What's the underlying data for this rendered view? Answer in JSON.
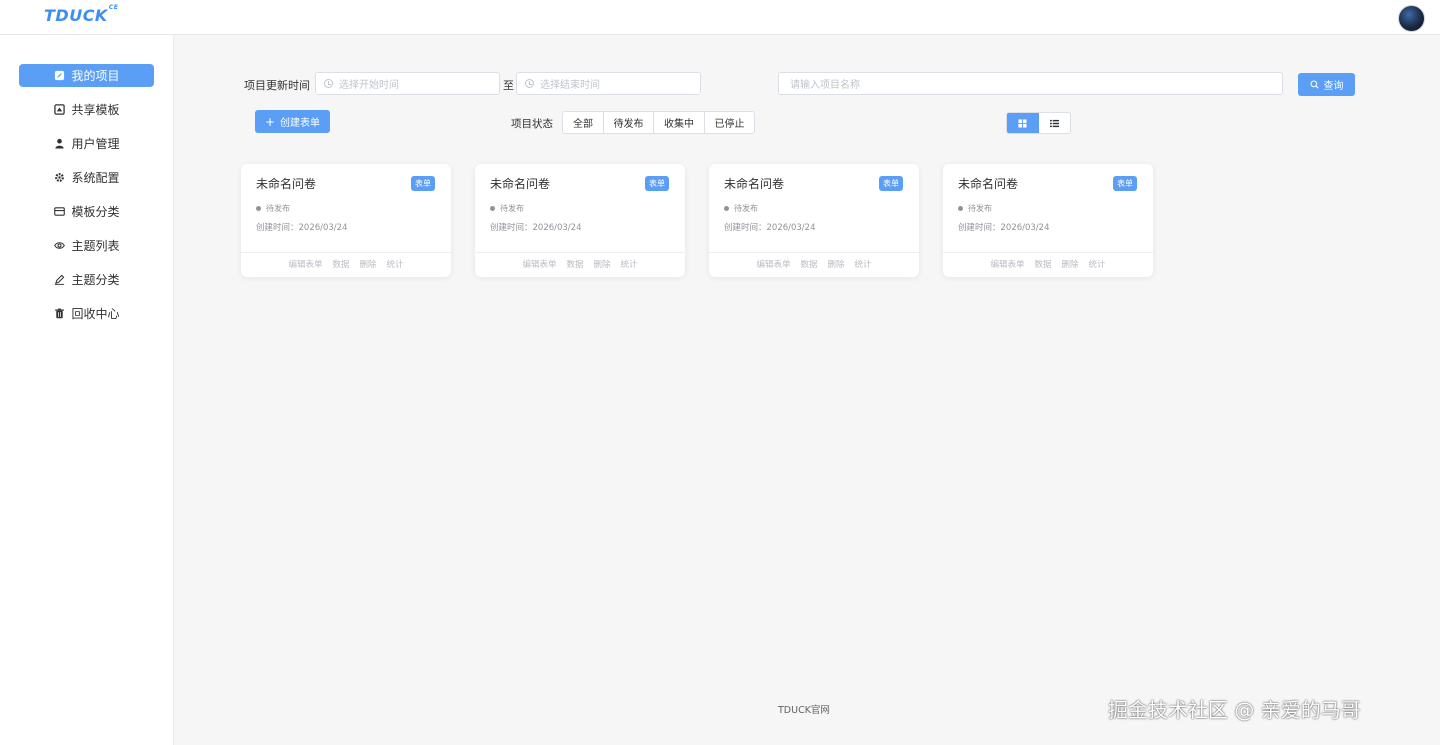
{
  "header": {
    "logo": "TDUCK",
    "logo_sup": "CE"
  },
  "sidebar": {
    "items": [
      {
        "label": "我的项目",
        "icon": "edit-icon",
        "active": true
      },
      {
        "label": "共享模板",
        "icon": "template-icon"
      },
      {
        "label": "用户管理",
        "icon": "user-icon"
      },
      {
        "label": "系统配置",
        "icon": "gear-icon"
      },
      {
        "label": "模板分类",
        "icon": "card-icon"
      },
      {
        "label": "主题列表",
        "icon": "eye-icon"
      },
      {
        "label": "主题分类",
        "icon": "pen-icon"
      },
      {
        "label": "回收中心",
        "icon": "trash-icon"
      }
    ]
  },
  "filters": {
    "update_time_label": "项目更新时间",
    "start_placeholder": "选择开始时间",
    "to_label": "至",
    "end_placeholder": "选择结束时间",
    "name_placeholder": "请输入项目名称",
    "search_label": "查询",
    "create_label": "创建表单",
    "status_label": "项目状态",
    "status_options": [
      "全部",
      "待发布",
      "收集中",
      "已停止"
    ]
  },
  "cards": [
    {
      "title": "未命名问卷",
      "badge": "表单",
      "status": "待发布",
      "created": "创建时间：2026/03/24",
      "actions": [
        "编辑表单",
        "数据",
        "删除",
        "统计"
      ]
    },
    {
      "title": "未命名问卷",
      "badge": "表单",
      "status": "待发布",
      "created": "创建时间：2026/03/24",
      "actions": [
        "编辑表单",
        "数据",
        "删除",
        "统计"
      ]
    },
    {
      "title": "未命名问卷",
      "badge": "表单",
      "status": "待发布",
      "created": "创建时间：2026/03/24",
      "actions": [
        "编辑表单",
        "数据",
        "删除",
        "统计"
      ]
    },
    {
      "title": "未命名问卷",
      "badge": "表单",
      "status": "待发布",
      "created": "创建时间：2026/03/24",
      "actions": [
        "编辑表单",
        "数据",
        "删除",
        "统计"
      ]
    }
  ],
  "footer": {
    "text": "TDUCK官网"
  },
  "watermark": {
    "text": "掘金技术社区 @ 亲爱的马哥"
  },
  "colors": {
    "primary": "#5b9ef5",
    "logo": "#3b8ff3"
  }
}
